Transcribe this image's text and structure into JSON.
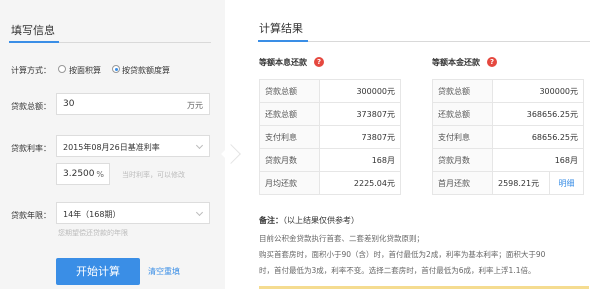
{
  "left": {
    "title": "填写信息",
    "method_label": "计算方式：",
    "method_options": [
      {
        "label": "按面积算",
        "checked": false
      },
      {
        "label": "按贷款额度算",
        "checked": true
      }
    ],
    "amount_label": "贷款总额：",
    "amount_value": "30",
    "amount_unit": "万元",
    "rate_label": "贷款利率：",
    "rate_select": "2015年08月26日基准利率",
    "rate_value": "3.2500",
    "rate_unit": "%",
    "rate_hint": "当时利率，可以修改",
    "term_label": "贷款年限：",
    "term_select": "14年（168期）",
    "term_hint": "您期望偿还贷款的年限",
    "calc_button": "开始计算",
    "reset_link": "清空重填"
  },
  "right": {
    "title": "计算结果",
    "equal_interest": {
      "title": "等额本息还款",
      "help_icon": "question-icon",
      "rows": [
        {
          "k": "贷款总额",
          "v": "300000元"
        },
        {
          "k": "还款总额",
          "v": "373807元"
        },
        {
          "k": "支付利息",
          "v": "73807元"
        },
        {
          "k": "贷款月数",
          "v": "168月"
        },
        {
          "k": "月均还款",
          "v": "2225.04元"
        }
      ]
    },
    "equal_principal": {
      "title": "等额本金还款",
      "help_icon": "question-icon",
      "rows": [
        {
          "k": "贷款总额",
          "v": "300000元"
        },
        {
          "k": "还款总额",
          "v": "368656.25元"
        },
        {
          "k": "支付利息",
          "v": "68656.25元"
        },
        {
          "k": "贷款月数",
          "v": "168月"
        }
      ],
      "first_month_label": "首月还款",
      "first_month_value": "2598.21元",
      "detail_link": "明细"
    },
    "note_title": "备注：",
    "note_sub": "（以上结果仅供参考）",
    "note_lines": [
      "目前公积金贷款执行首套、二套差别化贷款原则；",
      "购买首套房时，面积小于90（含）时，首付最低为2成，利率为基本利率；面积大于90",
      "时，首付最低为3成，利率不变。选择二套房时，首付最低为6成，利率上浮1.1倍。"
    ]
  },
  "colors": {
    "accent": "#3a8ee6",
    "danger": "#e5483f",
    "panel_bg": "#f5f5f5"
  }
}
